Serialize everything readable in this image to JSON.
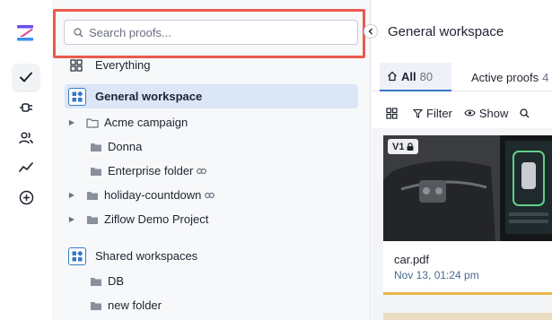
{
  "rail": {
    "icons": [
      "ziflow-logo",
      "check-icon",
      "integrations-icon",
      "people-icon",
      "analytics-icon",
      "add-circle-icon"
    ]
  },
  "sidebar": {
    "search_placeholder": "Search proofs...",
    "everything_label": "Everything",
    "general_workspace_label": "General workspace",
    "folders": [
      {
        "label": "Acme campaign",
        "has_caret": true,
        "linked": false
      },
      {
        "label": "Donna",
        "has_caret": false,
        "linked": false
      },
      {
        "label": "Enterprise folder",
        "has_caret": false,
        "linked": true
      },
      {
        "label": "holiday-countdown",
        "has_caret": true,
        "linked": true
      },
      {
        "label": "Ziflow Demo Project",
        "has_caret": true,
        "linked": false
      }
    ],
    "shared_workspaces_label": "Shared workspaces",
    "shared_folders": [
      {
        "label": "DB"
      },
      {
        "label": "new folder"
      }
    ]
  },
  "content": {
    "workspace_title": "General workspace",
    "tabs": [
      {
        "label": "All",
        "count": "80",
        "active": true
      },
      {
        "label": "Active proofs",
        "count": "4",
        "active": false
      }
    ],
    "toolbar": {
      "filter_label": "Filter",
      "show_label": "Show"
    },
    "proof": {
      "version": "V1",
      "name": "car.pdf",
      "date": "Nov 13, 01:24 pm"
    }
  },
  "colors": {
    "accent": "#3778c7",
    "highlight_border": "#ea5a4f",
    "card_status": "#e8b84a",
    "date_text": "#4a6a92"
  }
}
